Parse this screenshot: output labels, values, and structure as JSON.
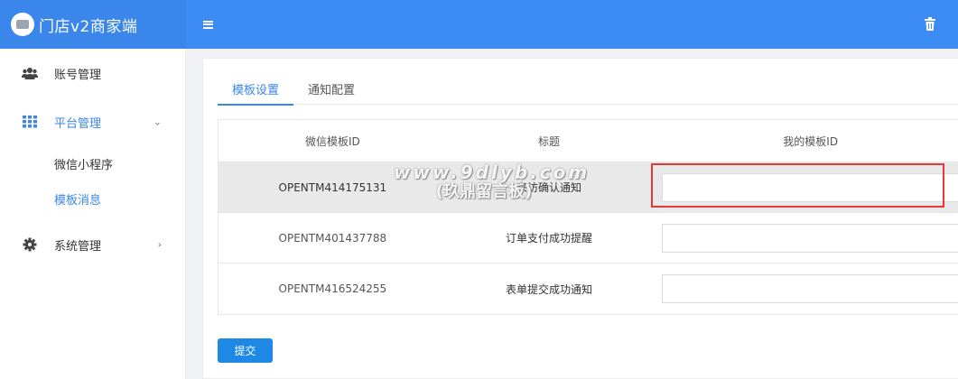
{
  "app": {
    "title": "门店v2商家端"
  },
  "header": {
    "menu_icon": "hamburger-icon",
    "trash_icon": "trash-icon"
  },
  "sidebar": {
    "items": [
      {
        "label": "账号管理",
        "icon": "users-icon"
      },
      {
        "label": "平台管理",
        "icon": "grid-icon",
        "expanded": true,
        "children": [
          {
            "label": "微信小程序"
          },
          {
            "label": "模板消息",
            "active": true
          }
        ]
      },
      {
        "label": "系统管理",
        "icon": "gear-icon"
      }
    ]
  },
  "tabs": [
    {
      "label": "模板设置",
      "active": true
    },
    {
      "label": "通知配置"
    }
  ],
  "table": {
    "headers": [
      "微信模板ID",
      "标题",
      "我的模板ID"
    ],
    "rows": [
      {
        "template_id": "OPENTM414175131",
        "title": "来访确认通知",
        "my_template_id": ""
      },
      {
        "template_id": "OPENTM401437788",
        "title": "订单支付成功提醒",
        "my_template_id": ""
      },
      {
        "template_id": "OPENTM416524255",
        "title": "表单提交成功通知",
        "my_template_id": ""
      }
    ]
  },
  "submit_label": "提交",
  "watermark": {
    "line1": "www.9dlyb.com",
    "line2": "(玖鼎留言板)"
  },
  "colors": {
    "primary": "#3a86eb",
    "highlight_box": "#e53935"
  }
}
